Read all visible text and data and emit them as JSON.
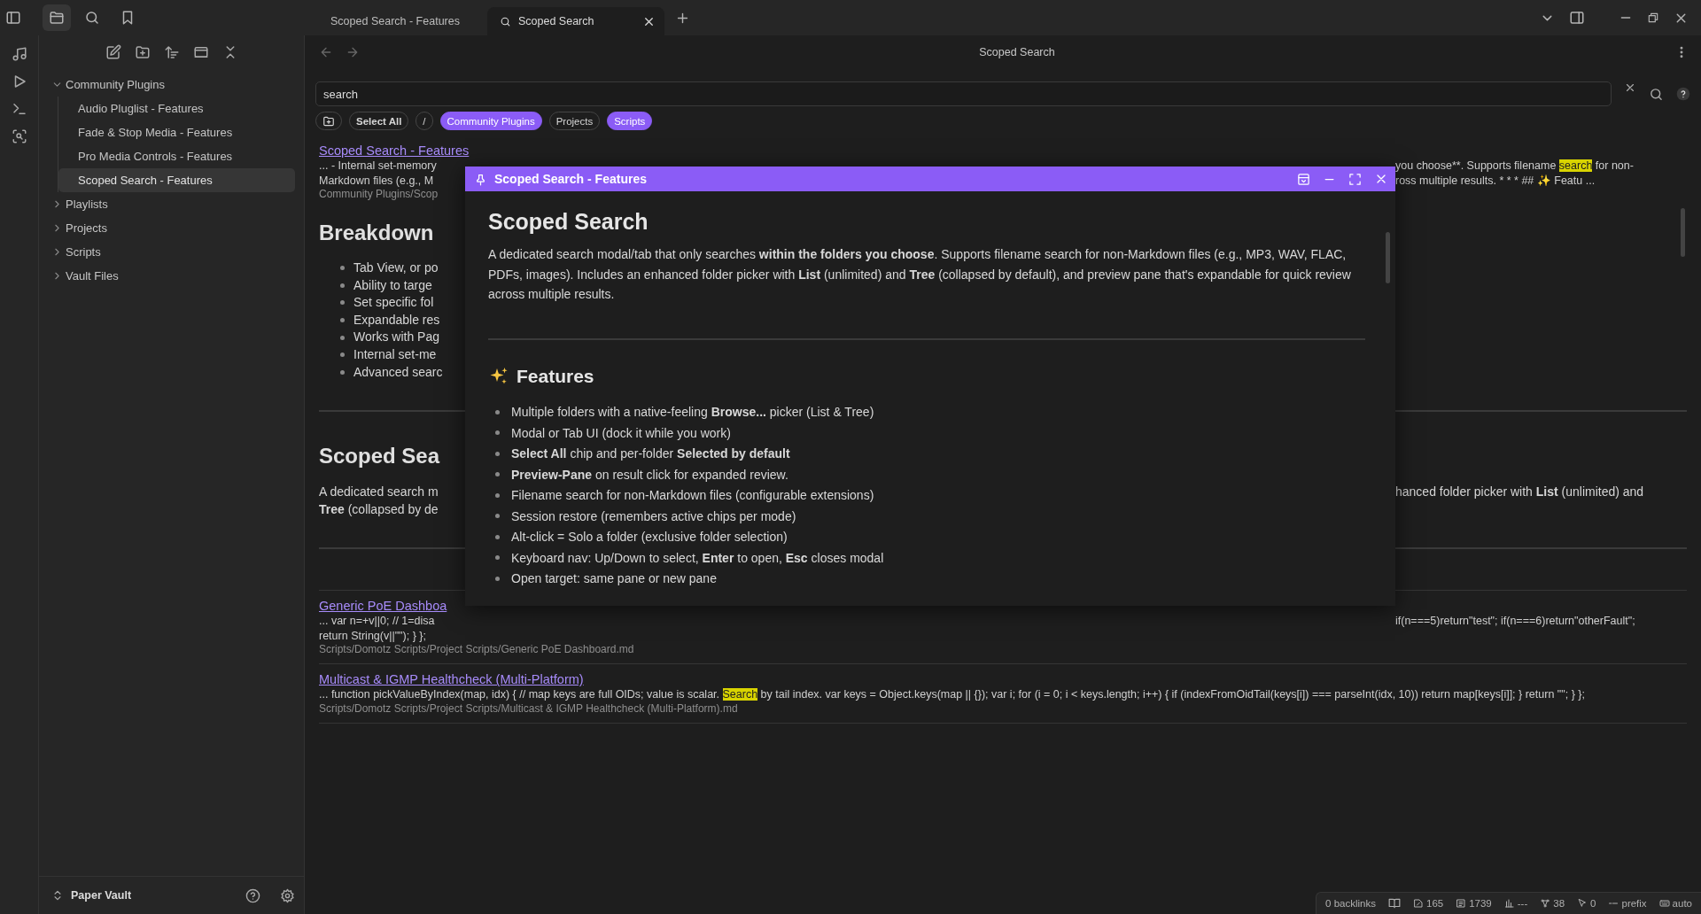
{
  "sidebar_tabs": [
    {
      "kind": "files",
      "selected": true
    },
    {
      "kind": "search",
      "selected": false
    },
    {
      "kind": "bookmarks",
      "selected": false
    }
  ],
  "tabs": [
    {
      "label": "Scoped Search - Features",
      "kind": "note",
      "selected": false
    },
    {
      "label": "Scoped Search",
      "kind": "search",
      "selected": true
    }
  ],
  "file_tree": [
    {
      "label": "Community Plugins",
      "expanded": true,
      "selected": false,
      "children": [
        {
          "label": "Audio Pluglist - Features",
          "selected": false
        },
        {
          "label": "Fade & Stop Media - Features",
          "selected": false
        },
        {
          "label": "Pro Media Controls - Features",
          "selected": false
        },
        {
          "label": "Scoped Search - Features",
          "selected": true
        }
      ]
    },
    {
      "label": "Playlists",
      "expanded": false,
      "selected": false
    },
    {
      "label": "Projects",
      "expanded": false,
      "selected": false
    },
    {
      "label": "Scripts",
      "expanded": false,
      "selected": false
    },
    {
      "label": "Vault Files",
      "expanded": false,
      "selected": false
    }
  ],
  "vault": {
    "name": "Paper Vault"
  },
  "view": {
    "title": "Scoped Search"
  },
  "search": {
    "value": "search"
  },
  "chips": [
    {
      "kind": "add_folder",
      "selected": false
    },
    {
      "kind": "action",
      "label": "Select All",
      "selected": false
    },
    {
      "kind": "folder",
      "label": "/",
      "selected": false
    },
    {
      "kind": "folder",
      "label": "Community Plugins",
      "selected": true
    },
    {
      "kind": "folder",
      "label": "Projects",
      "selected": false
    },
    {
      "kind": "folder",
      "label": "Scripts",
      "selected": true
    }
  ],
  "results": [
    {
      "title": "Scoped Search - Features",
      "lines": [
        {
          "kind": "split",
          "left": [
            {
              "text": "... - Internal set-memory",
              "match": false
            }
          ],
          "right": [
            {
              "text": "you choose**. Supports filename ",
              "match": false
            },
            {
              "text": "search",
              "match": true
            },
            {
              "text": " for non-",
              "match": false
            }
          ]
        },
        {
          "kind": "split",
          "left": [
            {
              "text": "Markdown files (e.g., M",
              "match": false
            }
          ],
          "right": [
            {
              "text": "ross multiple results. * * * ## ✨ Featu ...",
              "match": false
            }
          ]
        }
      ],
      "path": {
        "kind": "split",
        "left": "Community Plugins/Scop"
      },
      "preview": [
        {
          "kind": "heading",
          "text": "Breakdown"
        },
        {
          "kind": "list",
          "items": [
            "Tab View, or po",
            "Ability to targe",
            "Set specific fol",
            "Expandable res",
            "Works with Pag",
            "Internal set-me",
            "Advanced searc"
          ]
        },
        {
          "kind": "rule"
        },
        {
          "kind": "heading",
          "text": "Scoped Sea"
        },
        {
          "kind": "paragraph",
          "lines": [
            {
              "left": "A dedicated search m",
              "right": "hanced folder picker with **List** (unlimited) and"
            },
            {
              "left": "**Tree** (collapsed by de"
            }
          ]
        },
        {
          "kind": "rule"
        }
      ]
    },
    {
      "title": "Generic PoE Dashboa",
      "lines": [
        {
          "kind": "split",
          "left": [
            {
              "text": "... var n=+v||0; // 1=disa",
              "match": false
            }
          ],
          "right": [
            {
              "text": "if(n===5)return\"test\"; if(n===6)return\"otherFault\";",
              "match": false
            }
          ]
        },
        {
          "kind": "full",
          "segments": [
            {
              "text": "return String(v||\"\"); } };",
              "match": false
            }
          ]
        }
      ],
      "path": {
        "kind": "full",
        "text": "Scripts/Domotz Scripts/Project Scripts/Generic PoE Dashboard.md"
      }
    },
    {
      "title": "Multicast & IGMP Healthcheck (Multi-Platform)",
      "lines": [
        {
          "kind": "full",
          "segments": [
            {
              "text": "... function pickValueByIndex(map, idx) { // map keys are full OIDs; value is scalar. ",
              "match": false
            },
            {
              "text": "Search",
              "match": true
            },
            {
              "text": " by tail index. var keys = Object.keys(map || {}); var i; for (i = 0; i < keys.length; i++) { if (indexFromOidTail(keys[i]) === parseInt(idx, 10)) return map[keys[i]]; } return \"\"; } };",
              "match": false
            }
          ]
        }
      ],
      "path": {
        "kind": "full",
        "text": "Scripts/Domotz Scripts/Project Scripts/Multicast & IGMP Healthcheck (Multi-Platform).md"
      }
    }
  ],
  "modal": {
    "title": "Scoped Search - Features",
    "heading": "Scoped Search",
    "intro": "A dedicated search modal/tab that only searches **within the folders you choose**. Supports filename search for non-Markdown files (e.g., MP3, WAV, FLAC, PDFs, images). Includes an enhanced folder picker with **List** (unlimited) and **Tree** (collapsed by default), and preview pane that's expandable for quick review across multiple results.",
    "section": "Features",
    "items": [
      "Multiple folders with a native-feeling **Browse...** picker (List & Tree)",
      "Modal or Tab UI (dock it while you work)",
      "**Select All** chip and per-folder **Selected by default**",
      "**Preview-Pane** on result click for expanded review.",
      "Filename search for non-Markdown files (configurable extensions)",
      "Session restore (remembers active chips per mode)",
      "Alt-click = Solo a folder (exclusive folder selection)",
      "Keyboard nav: Up/Down to select, **Enter** to open, **Esc** closes modal",
      "Open target: same pane or new pane"
    ]
  },
  "status_bar": {
    "backlinks": "0 backlinks",
    "items": [
      {
        "kind": "reading"
      },
      {
        "kind": "edit",
        "text": "165"
      },
      {
        "kind": "words",
        "text": "1739"
      },
      {
        "kind": "chart",
        "text": "---"
      },
      {
        "kind": "links",
        "text": "38"
      },
      {
        "kind": "cursor",
        "text": "0"
      },
      {
        "kind": "prefix",
        "text": "prefix"
      },
      {
        "kind": "keyboard",
        "text": "auto"
      }
    ]
  }
}
